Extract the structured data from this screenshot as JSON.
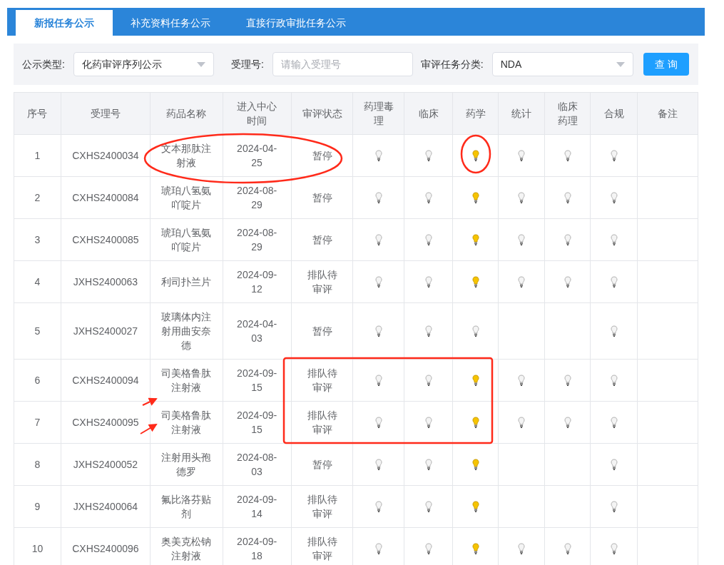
{
  "tabs": [
    {
      "label": "新报任务公示",
      "selected": true
    },
    {
      "label": "补充资料任务公示",
      "selected": false
    },
    {
      "label": "直接行政审批任务公示",
      "selected": false
    }
  ],
  "filters": {
    "type_label": "公示类型:",
    "type_value": "化药审评序列公示",
    "number_label": "受理号:",
    "number_placeholder": "请输入受理号",
    "category_label": "审评任务分类:",
    "category_value": "NDA",
    "query_button": "查 询"
  },
  "table": {
    "columns": [
      "序号",
      "受理号",
      "药品名称",
      "进入中心时间",
      "审评状态",
      "药理毒理",
      "临床",
      "药学",
      "统计",
      "临床药理",
      "合规",
      "备注"
    ],
    "rows": [
      {
        "index": "1",
        "number": "CXHS2400034",
        "drug": "文本那肽注射液",
        "date": "2024-04-25",
        "status": "暂停",
        "bulbs": [
          {
            "kind": "unlit"
          },
          {
            "kind": "unlit"
          },
          {
            "kind": "lit"
          },
          {
            "kind": "unlit"
          },
          {
            "kind": "unlit"
          },
          {
            "kind": "unlit"
          }
        ]
      },
      {
        "index": "2",
        "number": "CXHS2400084",
        "drug": "琥珀八氢氨吖啶片",
        "date": "2024-08-29",
        "status": "暂停",
        "bulbs": [
          {
            "kind": "unlit"
          },
          {
            "kind": "unlit"
          },
          {
            "kind": "lit"
          },
          {
            "kind": "unlit"
          },
          {
            "kind": "unlit"
          },
          {
            "kind": "unlit"
          }
        ]
      },
      {
        "index": "3",
        "number": "CXHS2400085",
        "drug": "琥珀八氢氨吖啶片",
        "date": "2024-08-29",
        "status": "暂停",
        "bulbs": [
          {
            "kind": "unlit"
          },
          {
            "kind": "unlit"
          },
          {
            "kind": "lit"
          },
          {
            "kind": "unlit"
          },
          {
            "kind": "unlit"
          },
          {
            "kind": "unlit"
          }
        ]
      },
      {
        "index": "4",
        "number": "JXHS2400063",
        "drug": "利司扑兰片",
        "date": "2024-09-12",
        "status": "排队待审评",
        "bulbs": [
          {
            "kind": "unlit"
          },
          {
            "kind": "unlit"
          },
          {
            "kind": "lit"
          },
          {
            "kind": "unlit"
          },
          {
            "kind": "unlit"
          },
          {
            "kind": "unlit"
          }
        ]
      },
      {
        "index": "5",
        "number": "JXHS2400027",
        "drug": "玻璃体内注射用曲安奈德",
        "date": "2024-04-03",
        "status": "暂停",
        "bulbs": [
          {
            "kind": "unlit"
          },
          {
            "kind": "unlit"
          },
          {
            "kind": "unlit"
          },
          {
            "kind": "none"
          },
          {
            "kind": "none"
          },
          {
            "kind": "unlit"
          }
        ]
      },
      {
        "index": "6",
        "number": "CXHS2400094",
        "drug": "司美格鲁肽注射液",
        "date": "2024-09-15",
        "status": "排队待审评",
        "bulbs": [
          {
            "kind": "unlit"
          },
          {
            "kind": "unlit"
          },
          {
            "kind": "lit"
          },
          {
            "kind": "unlit"
          },
          {
            "kind": "unlit"
          },
          {
            "kind": "unlit"
          }
        ]
      },
      {
        "index": "7",
        "number": "CXHS2400095",
        "drug": "司美格鲁肽注射液",
        "date": "2024-09-15",
        "status": "排队待审评",
        "bulbs": [
          {
            "kind": "unlit"
          },
          {
            "kind": "unlit"
          },
          {
            "kind": "lit"
          },
          {
            "kind": "unlit"
          },
          {
            "kind": "unlit"
          },
          {
            "kind": "unlit"
          }
        ]
      },
      {
        "index": "8",
        "number": "JXHS2400052",
        "drug": "注射用头孢德罗",
        "date": "2024-08-03",
        "status": "暂停",
        "bulbs": [
          {
            "kind": "unlit"
          },
          {
            "kind": "unlit"
          },
          {
            "kind": "lit"
          },
          {
            "kind": "none"
          },
          {
            "kind": "none"
          },
          {
            "kind": "unlit"
          }
        ]
      },
      {
        "index": "9",
        "number": "JXHS2400064",
        "drug": "氟比洛芬贴剂",
        "date": "2024-09-14",
        "status": "排队待审评",
        "bulbs": [
          {
            "kind": "unlit"
          },
          {
            "kind": "unlit"
          },
          {
            "kind": "lit"
          },
          {
            "kind": "none"
          },
          {
            "kind": "none"
          },
          {
            "kind": "unlit"
          }
        ]
      },
      {
        "index": "10",
        "number": "CXHS2400096",
        "drug": "奥美克松钠注射液",
        "date": "2024-09-18",
        "status": "排队待审评",
        "bulbs": [
          {
            "kind": "unlit"
          },
          {
            "kind": "unlit"
          },
          {
            "kind": "lit"
          },
          {
            "kind": "unlit"
          },
          {
            "kind": "unlit"
          },
          {
            "kind": "unlit"
          }
        ]
      }
    ]
  }
}
